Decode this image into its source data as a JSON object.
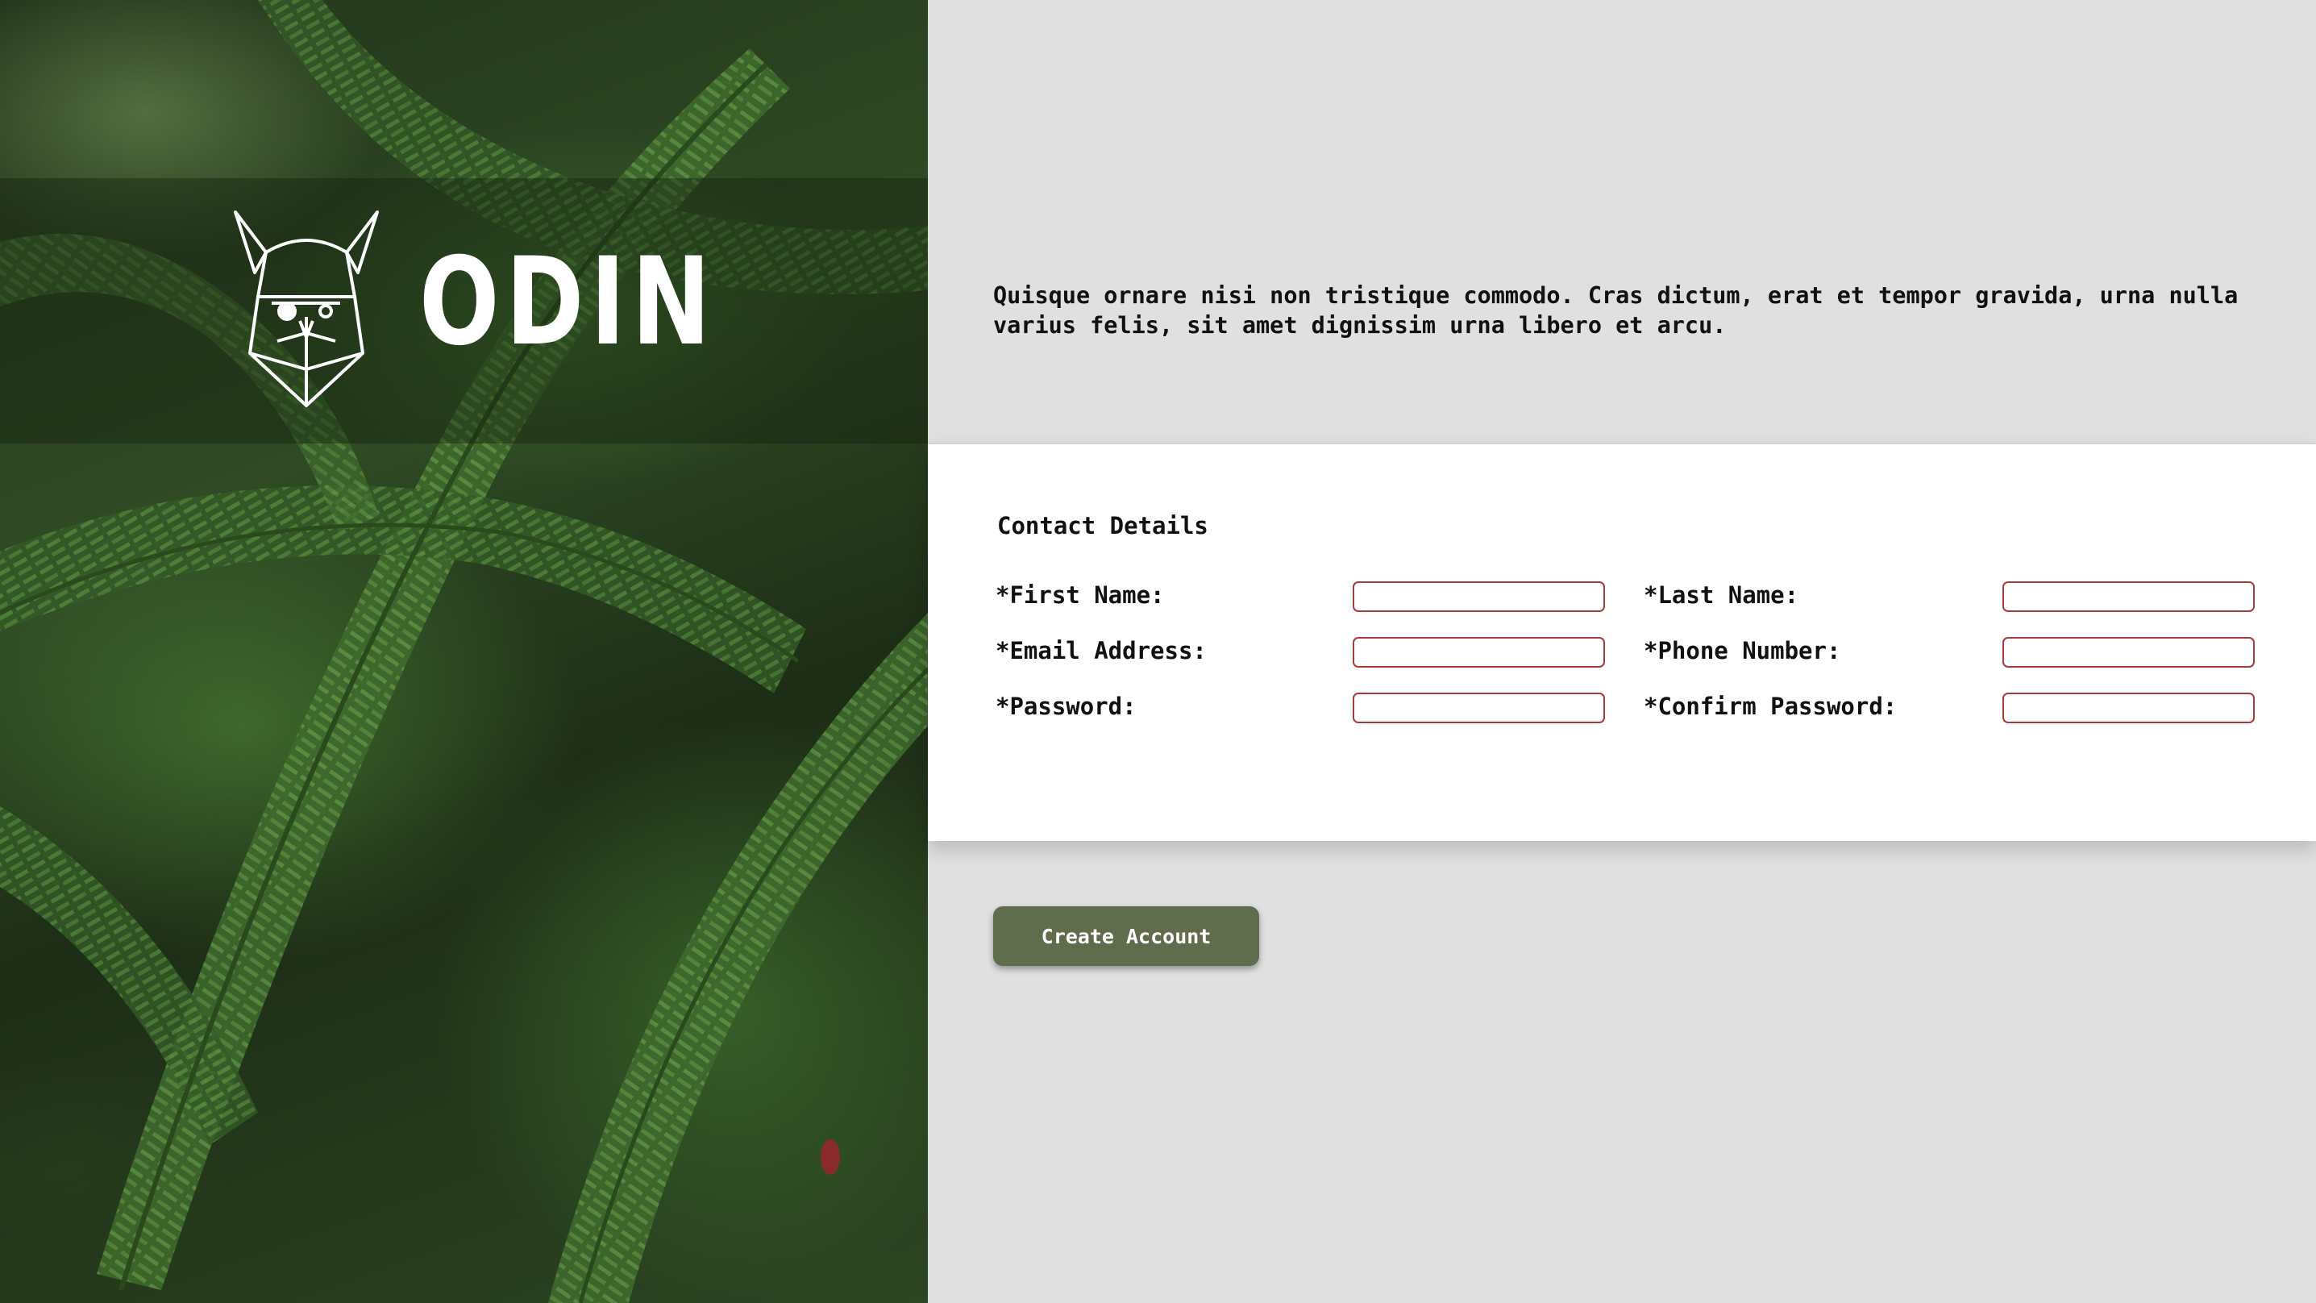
{
  "brand": {
    "name": "ODIN",
    "logo_icon": "viking-head-icon"
  },
  "intro": {
    "text": "Quisque ornare nisi non tristique commodo. Cras dictum, erat et tempor gravida, urna nulla varius felis, sit amet dignissim urna libero et arcu."
  },
  "form": {
    "title": "Contact Details",
    "fields": [
      {
        "label": "*First Name:",
        "value": ""
      },
      {
        "label": "*Last Name:",
        "value": ""
      },
      {
        "label": "*Email Address:",
        "value": ""
      },
      {
        "label": "*Phone Number:",
        "value": ""
      },
      {
        "label": "*Password:",
        "value": ""
      },
      {
        "label": "*Confirm Password:",
        "value": ""
      }
    ]
  },
  "actions": {
    "create_label": "Create Account"
  },
  "colors": {
    "page_background": "#e0e0e0",
    "input_border": "#a83a3a",
    "button": "#5f6d4d",
    "hero_green": "#2f4a24"
  }
}
